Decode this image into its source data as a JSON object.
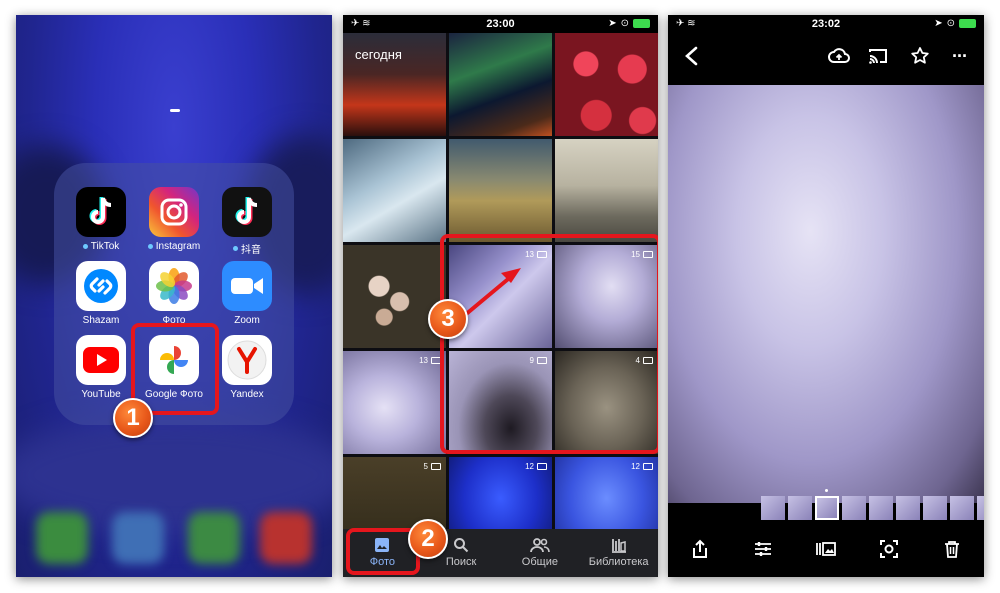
{
  "panel1": {
    "apps": [
      {
        "label": "TikTok",
        "icon": "tiktok-icon",
        "dot": true
      },
      {
        "label": "Instagram",
        "icon": "instagram-icon",
        "dot": true
      },
      {
        "label": "抖音",
        "icon": "douyin-icon",
        "dot": true
      },
      {
        "label": "Shazam",
        "icon": "shazam-icon",
        "dot": false
      },
      {
        "label": "Фото",
        "icon": "photos-icon",
        "dot": false
      },
      {
        "label": "Zoom",
        "icon": "zoom-icon",
        "dot": false
      },
      {
        "label": "YouTube",
        "icon": "youtube-icon",
        "dot": false
      },
      {
        "label": "Google Фото",
        "icon": "google-photos-icon",
        "dot": false
      },
      {
        "label": "Yandex",
        "icon": "yandex-icon",
        "dot": false
      }
    ],
    "step_badge": "1"
  },
  "panel2": {
    "status": {
      "time": "23:00"
    },
    "section_label": "сегодня",
    "video_tiles": [
      {
        "count": "13"
      },
      {
        "count": "15"
      },
      {
        "count": "13"
      },
      {
        "count": "9"
      },
      {
        "count": "4"
      },
      {
        "count": "5"
      },
      {
        "count": "12"
      },
      {
        "count": "12"
      }
    ],
    "tabs": [
      {
        "label": "Фото",
        "icon": "photo-icon"
      },
      {
        "label": "Поиск",
        "icon": "search-icon"
      },
      {
        "label": "Общие",
        "icon": "people-icon"
      },
      {
        "label": "Библиотека",
        "icon": "library-icon"
      }
    ],
    "step_badges": [
      "2",
      "3"
    ]
  },
  "panel3": {
    "status": {
      "time": "23:02"
    },
    "top_icons": [
      "back-icon",
      "cloud-upload-icon",
      "cast-icon",
      "star-icon",
      "more-icon"
    ],
    "bottom_icons": [
      "share-icon",
      "edit-icon",
      "slideshow-icon",
      "lens-icon",
      "delete-icon"
    ]
  },
  "colors": {
    "accent_red": "#e5161d",
    "badge_orange": "#e8581a"
  }
}
